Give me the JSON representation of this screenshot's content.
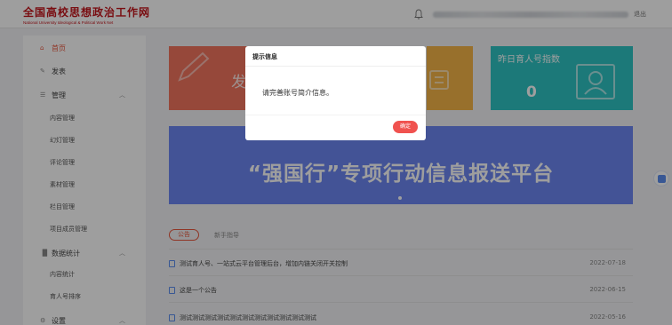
{
  "header": {
    "logo_cn": "全国高校思想政治工作网",
    "logo_en": "National University Ideological & Political Work Net",
    "logout": "退出"
  },
  "sidebar": {
    "items": [
      {
        "label": "首页",
        "icon": "home-icon",
        "active": true
      },
      {
        "label": "发表",
        "icon": "edit-icon"
      },
      {
        "label": "管理",
        "icon": "list-icon",
        "expanded": true
      },
      {
        "label": "数据统计",
        "icon": "bar-chart-icon",
        "expanded": true
      },
      {
        "label": "设置",
        "icon": "gear-icon",
        "expanded": true
      }
    ],
    "manage_sub": [
      "内容管理",
      "幻灯管理",
      "评论管理",
      "素材管理",
      "栏目管理",
      "项目成员管理"
    ],
    "stats_sub": [
      "内容统计",
      "育人号排序"
    ]
  },
  "cards": {
    "publish": "发表",
    "yesterday_label": "昨日育人号指数",
    "yesterday_value": "0"
  },
  "banner": {
    "text": "“强国行”专项行动信息报送平台"
  },
  "tabs": {
    "active": "公告",
    "other": "新手指导"
  },
  "notices": [
    {
      "title": "测试育人号、一站式云平台管理后台，增加内链关闭开关控制",
      "date": "2022-07-18"
    },
    {
      "title": "这是一个公告",
      "date": "2022-06-15"
    },
    {
      "title": "测试测试测试测试测试测试测试测试测试测试测试",
      "date": "2022-05-16"
    }
  ],
  "dialog": {
    "title": "提示信息",
    "message": "请完善账号简介信息。",
    "ok": "确定"
  },
  "colors": {
    "accent": "#e8563d",
    "card_red": "#f2745e",
    "card_orange": "#f5b547",
    "card_teal": "#2ec4c4",
    "banner": "#6d87f2",
    "ok_button": "#f0524f"
  }
}
